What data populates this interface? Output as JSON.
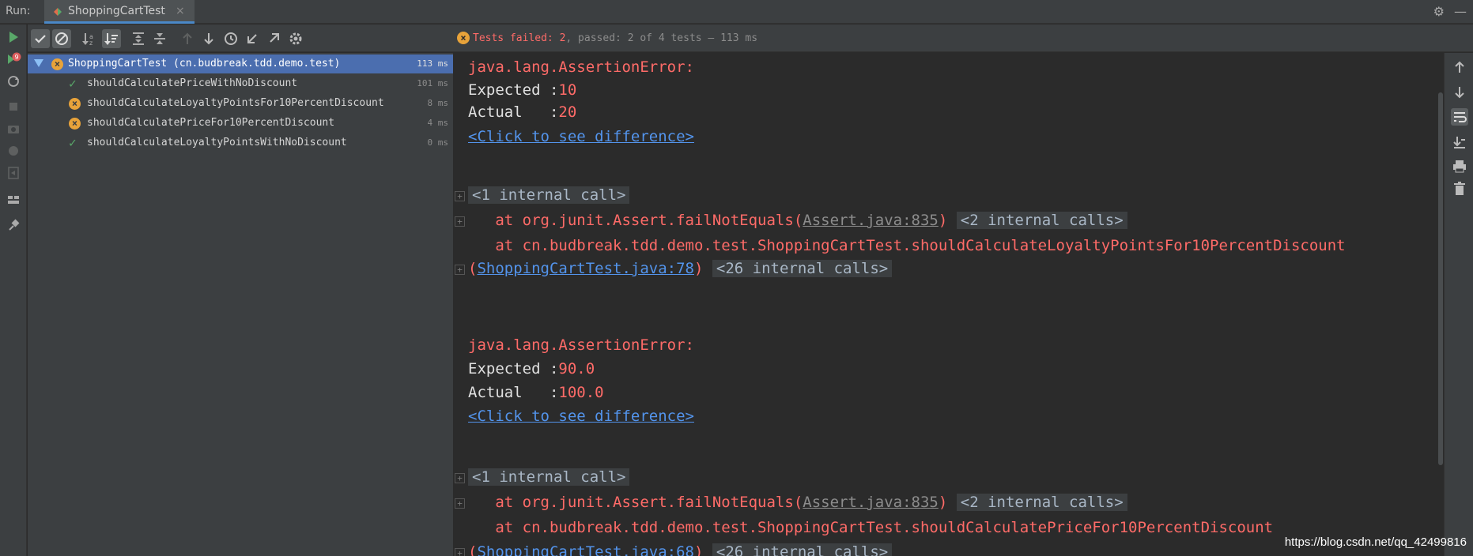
{
  "run_bar": {
    "label": "Run:",
    "tab_title": "ShoppingCartTest",
    "tab_close": "×"
  },
  "status": {
    "prefix": "Tests failed: ",
    "failed": "2",
    "sep": ", passed: ",
    "passed": "2",
    "suffix": " of 4 tests",
    "duration": " – 113 ms"
  },
  "left_toolbar": {
    "fail_count_badge": "9"
  },
  "tree": {
    "root": {
      "label": "ShoppingCartTest (cn.budbreak.tdd.demo.test)",
      "time": "113 ms",
      "status": "failed"
    },
    "items": [
      {
        "label": "shouldCalculatePriceWithNoDiscount",
        "time": "101 ms",
        "status": "passed"
      },
      {
        "label": "shouldCalculateLoyaltyPointsFor10PercentDiscount",
        "time": "8 ms",
        "status": "failed"
      },
      {
        "label": "shouldCalculatePriceFor10PercentDiscount",
        "time": "4 ms",
        "status": "failed"
      },
      {
        "label": "shouldCalculateLoyaltyPointsWithNoDiscount",
        "time": "0 ms",
        "status": "passed"
      }
    ]
  },
  "console": {
    "block1": {
      "error": "java.lang.AssertionError:",
      "expected_label": "Expected :",
      "expected_value": "10",
      "actual_label": "Actual   :",
      "actual_value": "20",
      "diff_link": "<Click to see difference>",
      "internal1": "<1 internal call>",
      "at1_prefix": "at org.junit.Assert.failNotEquals(",
      "at1_link": "Assert.java:835",
      "at1_suffix": ")",
      "internal2": "<2 internal calls>",
      "at2": "at cn.budbreak.tdd.demo.test.ShoppingCartTest.shouldCalculateLoyaltyPointsFor10PercentDiscount",
      "at2_open": "(",
      "at2_link": "ShoppingCartTest.java:78",
      "at2_close": ")",
      "internal3": "<26 internal calls>"
    },
    "block2": {
      "error": "java.lang.AssertionError:",
      "expected_label": "Expected :",
      "expected_value": "90.0",
      "actual_label": "Actual   :",
      "actual_value": "100.0",
      "diff_link": "<Click to see difference>",
      "internal1": "<1 internal call>",
      "at1_prefix": "at org.junit.Assert.failNotEquals(",
      "at1_link": "Assert.java:835",
      "at1_suffix": ")",
      "internal2": "<2 internal calls>",
      "at2": "at cn.budbreak.tdd.demo.test.ShoppingCartTest.shouldCalculatePriceFor10PercentDiscount",
      "at2_open": "(",
      "at2_link": "ShoppingCartTest.java:68",
      "at2_close": ")",
      "internal3": "<26 internal calls>"
    }
  },
  "watermark": "https://blog.csdn.net/qq_42499816",
  "colors": {
    "error_red": "#ff6b68",
    "link_blue": "#5394ec",
    "pass_green": "#59a869",
    "fail_orange": "#e8a33a",
    "selection": "#4b6eaf"
  }
}
